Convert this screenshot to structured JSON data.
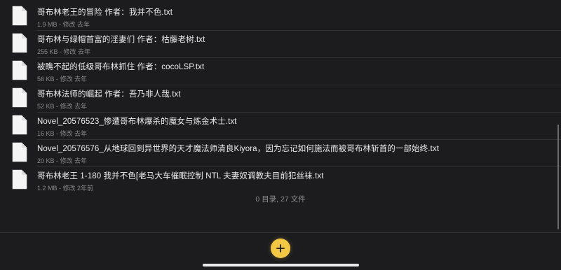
{
  "files": [
    {
      "name": "哥布林老王的冒险 作者：我并不色.txt",
      "meta": "1.9 MB - 修改 去年",
      "icon": "document-icon"
    },
    {
      "name": "哥布林与绿帽首富的淫妻们 作者：枯藤老树.txt",
      "meta": "255 KB - 修改 去年",
      "icon": "document-icon"
    },
    {
      "name": "被瞧不起的低级哥布林抓住 作者：cocoLSP.txt",
      "meta": "56 KB - 修改 去年",
      "icon": "document-icon"
    },
    {
      "name": "哥布林法师的崛起 作者：吾乃非人哉.txt",
      "meta": "52 KB - 修改 去年",
      "icon": "document-icon"
    },
    {
      "name": "Novel_20576523_惨遭哥布林爆杀的魔女与炼金术士.txt",
      "meta": "16 KB - 修改 去年",
      "icon": "document-icon"
    },
    {
      "name": "Novel_20576576_从地球回到异世界的天才魔法师清良Kiyora，因为忘记如何施法而被哥布林斩首的一部始终.txt",
      "meta": "20 KB - 修改 去年",
      "icon": "document-icon"
    },
    {
      "name": "哥布林老王 1-180 我并不色[老马大车催眠控制 NTL 夫妻奴调教夫目前犯丝袜.txt",
      "meta": "1.2 MB - 修改 2年前",
      "icon": "document-icon"
    }
  ],
  "summary": "0 目录, 27 文件",
  "toolbar": {
    "add_icon": "plus-icon",
    "accent": "#f2c744"
  },
  "colors": {
    "background": "#1c1c1e",
    "text": "#ececec",
    "secondary_text": "#8a8a8e"
  }
}
